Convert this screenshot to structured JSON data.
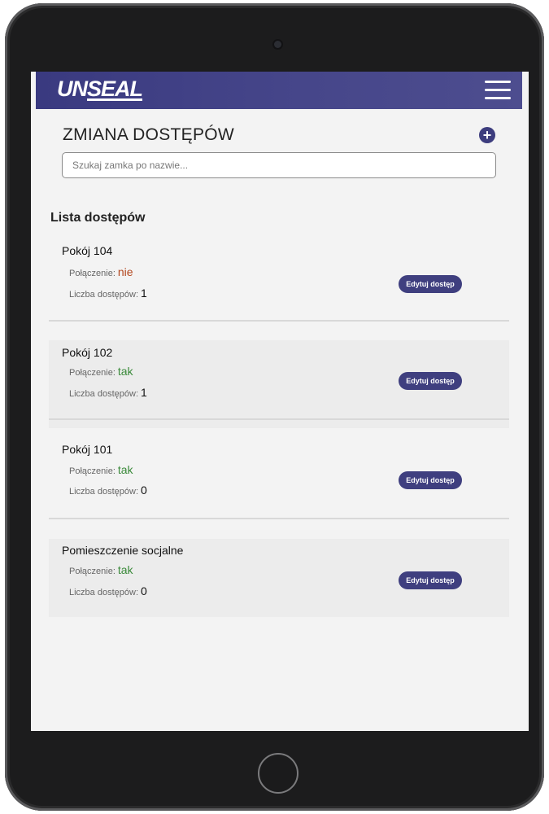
{
  "header": {
    "logo_un": "UN",
    "logo_seal": "SEAL"
  },
  "page": {
    "title": "ZMIANA DOSTĘPÓW",
    "search_placeholder": "Szukaj zamka po nazwie...",
    "section_title": "Lista dostępów"
  },
  "labels": {
    "connection": "Połączenie:",
    "access_count": "Liczba dostępów:",
    "edit_button": "Edytuj dostęp"
  },
  "locks": [
    {
      "name": "Pokój 104",
      "connection": "nie",
      "access_count": "1"
    },
    {
      "name": "Pokój 102",
      "connection": "tak",
      "access_count": "1"
    },
    {
      "name": "Pokój 101",
      "connection": "tak",
      "access_count": "0"
    },
    {
      "name": "Pomieszczenie socjalne",
      "connection": "tak",
      "access_count": "0"
    }
  ],
  "colors": {
    "brand": "#3a3a80",
    "status_no": "#b3471e",
    "status_yes": "#3a8a3a"
  },
  "icons": {
    "menu": "hamburger-icon",
    "add": "plus-circle-icon"
  }
}
